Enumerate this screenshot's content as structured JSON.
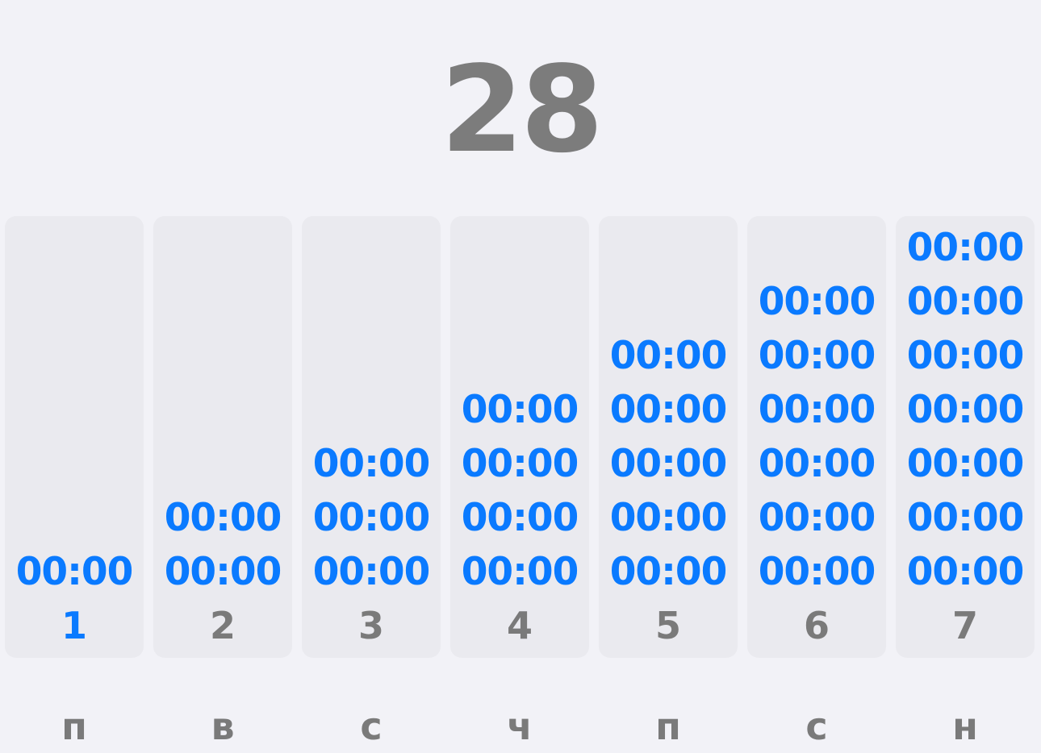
{
  "total": "28",
  "active_day_index": 0,
  "days": [
    {
      "number": "1",
      "weekday": "п",
      "times": [
        "00:00"
      ]
    },
    {
      "number": "2",
      "weekday": "в",
      "times": [
        "00:00",
        "00:00"
      ]
    },
    {
      "number": "3",
      "weekday": "с",
      "times": [
        "00:00",
        "00:00",
        "00:00"
      ]
    },
    {
      "number": "4",
      "weekday": "ч",
      "times": [
        "00:00",
        "00:00",
        "00:00",
        "00:00"
      ]
    },
    {
      "number": "5",
      "weekday": "п",
      "times": [
        "00:00",
        "00:00",
        "00:00",
        "00:00",
        "00:00"
      ]
    },
    {
      "number": "6",
      "weekday": "с",
      "times": [
        "00:00",
        "00:00",
        "00:00",
        "00:00",
        "00:00",
        "00:00"
      ]
    },
    {
      "number": "7",
      "weekday": "н",
      "times": [
        "00:00",
        "00:00",
        "00:00",
        "00:00",
        "00:00",
        "00:00",
        "00:00"
      ]
    }
  ],
  "colors": {
    "accent": "#0a7aff",
    "muted_text": "#7a7a7a",
    "column_bg": "#eaeaef",
    "page_bg": "#f2f2f7"
  }
}
